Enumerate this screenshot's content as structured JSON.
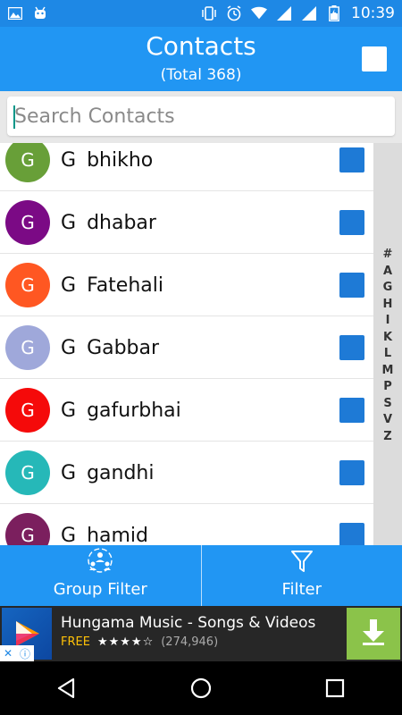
{
  "status_bar": {
    "time": "10:39",
    "left_icons": [
      "image-icon",
      "android-icon"
    ],
    "right_icons": [
      "vibrate-icon",
      "alarm-icon",
      "wifi-icon",
      "signal-icon",
      "signal-icon",
      "battery-charging-icon"
    ]
  },
  "header": {
    "title": "Contacts",
    "subtitle": "(Total 368)"
  },
  "search": {
    "placeholder": "Search Contacts",
    "value": ""
  },
  "contacts": [
    {
      "initial": "G",
      "group": "G",
      "name": "bhikho",
      "color": "#689f38"
    },
    {
      "initial": "G",
      "group": "G",
      "name": "dhabar",
      "color": "#7b0a85"
    },
    {
      "initial": "G",
      "group": "G",
      "name": "Fatehali",
      "color": "#ff5722"
    },
    {
      "initial": "G",
      "group": "G",
      "name": "Gabbar",
      "color": "#9fa8da"
    },
    {
      "initial": "G",
      "group": "G",
      "name": "gafurbhai",
      "color": "#f50a0a"
    },
    {
      "initial": "G",
      "group": "G",
      "name": "gandhi",
      "color": "#26b8b8"
    },
    {
      "initial": "G",
      "group": "G",
      "name": "hamid",
      "color": "#7b1f5e"
    }
  ],
  "alphabet_index": [
    "#",
    "A",
    "G",
    "H",
    "I",
    "K",
    "L",
    "M",
    "P",
    "S",
    "V",
    "Z"
  ],
  "filters": {
    "group_filter_label": "Group Filter",
    "filter_label": "Filter"
  },
  "ad": {
    "title": "Hungama Music - Songs & Videos",
    "price": "FREE",
    "stars": "★★★★☆",
    "rating_count": "(274,946)"
  },
  "colors": {
    "primary": "#2196f3",
    "status_bar": "#1e88e5",
    "checkbox": "#1e7ad6",
    "ad_download": "#8bc34a"
  }
}
